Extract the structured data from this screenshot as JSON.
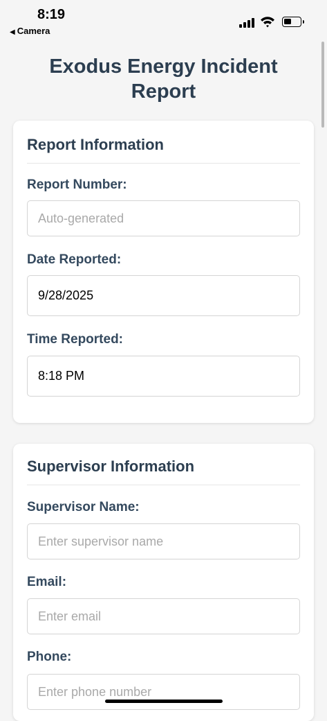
{
  "status_bar": {
    "time": "8:19",
    "back_app": "Camera",
    "back_glyph": "◀"
  },
  "header": {
    "title": "Exodus Energy Incident Report"
  },
  "report_info": {
    "heading": "Report Information",
    "report_number_label": "Report Number:",
    "report_number_placeholder": "Auto-generated",
    "date_label": "Date Reported:",
    "date_value": "9/28/2025",
    "time_label": "Time Reported:",
    "time_value": "8:18 PM"
  },
  "supervisor_info": {
    "heading": "Supervisor Information",
    "name_label": "Supervisor Name:",
    "name_placeholder": "Enter supervisor name",
    "email_label": "Email:",
    "email_placeholder": "Enter email",
    "phone_label": "Phone:",
    "phone_placeholder": "Enter phone number"
  },
  "colors": {
    "heading": "#2c3e50",
    "label": "#34495e",
    "background": "#f5f5f5",
    "card": "#ffffff",
    "placeholder": "#a9a9a9"
  }
}
